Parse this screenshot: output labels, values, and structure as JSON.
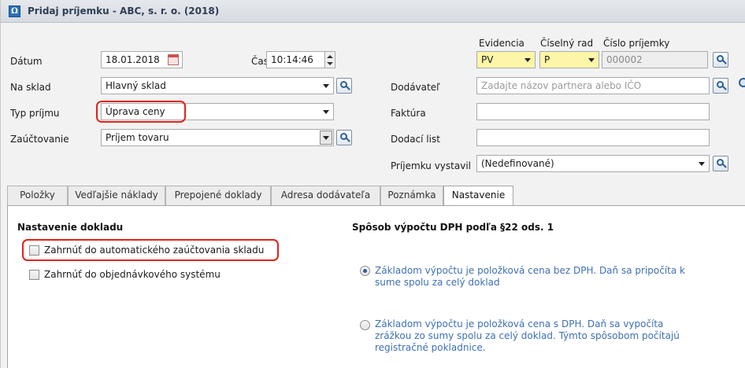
{
  "window": {
    "title": "Pridaj príjemku - ABC, s. r. o. (2018)",
    "app_icon_glyph": "Ω"
  },
  "header": {
    "evidencia_label": "Evidencia",
    "evidencia_value": "PV",
    "ciselny_rad_label": "Číselný rad",
    "ciselny_rad_value": "P",
    "cislo_prijemky_label": "Číslo príjemky",
    "cislo_prijemky_value": "000002"
  },
  "form": {
    "datum_label": "Dátum",
    "datum_value": "18.01.2018",
    "cas_label": "Čas",
    "cas_value": "10:14:46",
    "na_sklad_label": "Na sklad",
    "na_sklad_value": "Hlavný sklad",
    "typ_prijmu_label": "Typ príjmu",
    "typ_prijmu_value": "Úprava ceny",
    "zauctovanie_label": "Zaúčtovanie",
    "zauctovanie_value": "Príjem tovaru",
    "dodavatel_label": "Dodávateľ",
    "dodavatel_placeholder": "Zadajte názov partnera alebo IČO",
    "faktura_label": "Faktúra",
    "faktura_value": "",
    "dodaci_list_label": "Dodací list",
    "dodaci_list_value": "",
    "vystavil_label": "Príjemku vystavil",
    "vystavil_value": "(Nedefinované)"
  },
  "tabs": [
    {
      "label": "Položky"
    },
    {
      "label": "Vedľajšie náklady"
    },
    {
      "label": "Prepojené doklady"
    },
    {
      "label": "Adresa dodávateľa"
    },
    {
      "label": "Poznámka"
    },
    {
      "label": "Nastavenie",
      "active": true
    }
  ],
  "settings": {
    "section_title": "Nastavenie dokladu",
    "checkbox_1_label": "Zahrnúť do automatického zaúčtovania skladu",
    "checkbox_1_checked": false,
    "checkbox_2_label": "Zahrnúť do objednávkového systému",
    "checkbox_2_checked": false
  },
  "dph": {
    "section_title": "Spôsob výpočtu DPH podľa §22 ods. 1",
    "option_1_line_1": "Základom výpočtu je položková cena bez DPH. Daň sa pripočíta k",
    "option_1_line_2": "sume spolu za celý doklad",
    "option_1_selected": true,
    "option_2_line_1": "Základom výpočtu je položková cena s DPH. Daň sa vypočíta",
    "option_2_line_2": "zrážkou zo sumy spolu za celý doklad. Týmto spôsobom počítajú",
    "option_2_line_3": "registračné pokladnice.",
    "option_2_selected": false
  },
  "colors": {
    "highlight_ring": "#e2231a",
    "required_field": "#fdf6a8",
    "link_text": "#3d6fb5"
  }
}
